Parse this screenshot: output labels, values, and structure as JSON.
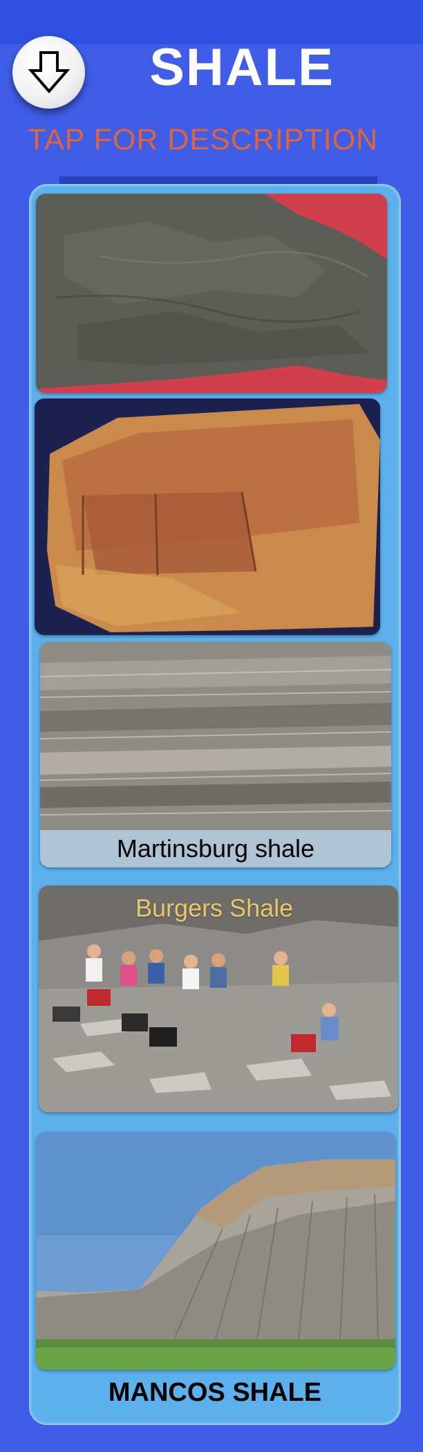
{
  "header": {
    "title": "SHALE",
    "subtitle": "TAP FOR DESCRIPTION",
    "back_icon": "arrow-down-icon"
  },
  "gallery": {
    "items": [
      {
        "caption": ""
      },
      {
        "caption": ""
      },
      {
        "caption": "Martinsburg shale"
      },
      {
        "caption": "Burgers Shale"
      },
      {
        "caption": "MANCOS SHALE"
      }
    ]
  },
  "colors": {
    "background": "#3f5de6",
    "panel": "#5cb0ec",
    "subtitle": "#e0643a",
    "title": "#ffffff"
  }
}
